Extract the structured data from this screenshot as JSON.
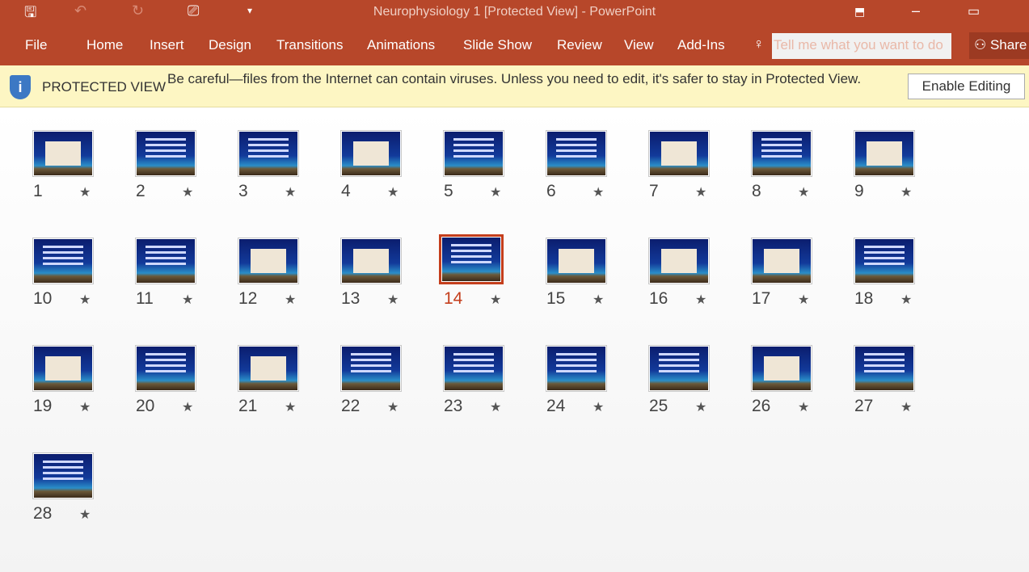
{
  "window": {
    "title": "Neurophysiology 1 [Protected View] - PowerPoint"
  },
  "quick_access": [
    {
      "icon": "save-icon",
      "glyph": "🖫"
    },
    {
      "icon": "undo-icon",
      "glyph": "↶"
    },
    {
      "icon": "redo-icon",
      "glyph": "↻"
    },
    {
      "icon": "slideshow-from-start-icon",
      "glyph": "⎚"
    },
    {
      "icon": "customize-dropdown-icon",
      "glyph": "▾"
    }
  ],
  "ribbon": {
    "tabs": [
      "File",
      "Home",
      "Insert",
      "Design",
      "Transitions",
      "Animations",
      "Slide Show",
      "Review",
      "View",
      "Add-Ins"
    ],
    "search_placeholder": "Tell me what you want to do",
    "share_label": "Share"
  },
  "protected_view": {
    "label": "PROTECTED VIEW",
    "message": "Be careful—files from the Internet can contain viruses. Unless you need to edit, it's safer to stay in Protected View.",
    "button": "Enable Editing"
  },
  "colors": {
    "accent": "#b7472a",
    "selected": "#c43e1c"
  },
  "selected_slide": 14,
  "slides": [
    {
      "n": "1",
      "image": true
    },
    {
      "n": "2",
      "image": false
    },
    {
      "n": "3",
      "image": false
    },
    {
      "n": "4",
      "image": true
    },
    {
      "n": "5",
      "image": false
    },
    {
      "n": "6",
      "image": false
    },
    {
      "n": "7",
      "image": true
    },
    {
      "n": "8",
      "image": false
    },
    {
      "n": "9",
      "image": true
    },
    {
      "n": "10",
      "image": false
    },
    {
      "n": "11",
      "image": false
    },
    {
      "n": "12",
      "image": true
    },
    {
      "n": "13",
      "image": true
    },
    {
      "n": "14",
      "image": false
    },
    {
      "n": "15",
      "image": true
    },
    {
      "n": "16",
      "image": true
    },
    {
      "n": "17",
      "image": true
    },
    {
      "n": "18",
      "image": false
    },
    {
      "n": "19",
      "image": true
    },
    {
      "n": "20",
      "image": false
    },
    {
      "n": "21",
      "image": true
    },
    {
      "n": "22",
      "image": false
    },
    {
      "n": "23",
      "image": false
    },
    {
      "n": "24",
      "image": false
    },
    {
      "n": "25",
      "image": false
    },
    {
      "n": "26",
      "image": true
    },
    {
      "n": "27",
      "image": false
    },
    {
      "n": "28",
      "image": false
    }
  ]
}
